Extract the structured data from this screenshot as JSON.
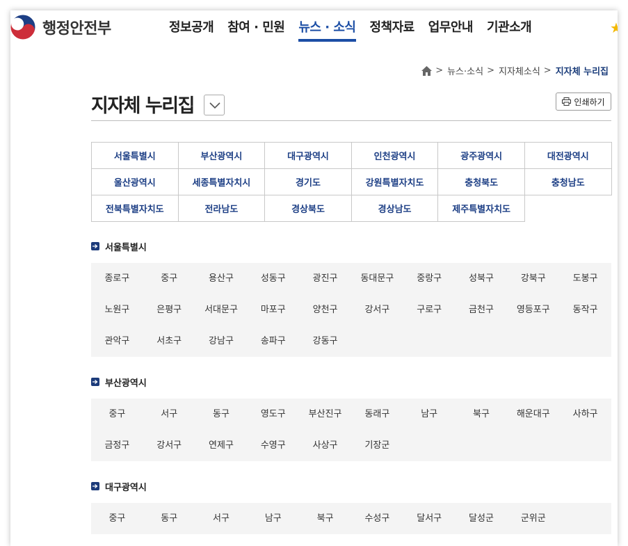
{
  "header": {
    "logo_text": "행정안전부",
    "nav": [
      "정보공개",
      "참여 · 민원",
      "뉴스 · 소식",
      "정책자료",
      "업무안내",
      "기관소개"
    ],
    "active_nav_index": 2
  },
  "breadcrumb": {
    "items": [
      "뉴스·소식",
      "지자체소식"
    ],
    "current": "지자체 누리집"
  },
  "page": {
    "title": "지자체 누리집",
    "print_label": "인쇄하기"
  },
  "regions": [
    [
      "서울특별시",
      "부산광역시",
      "대구광역시",
      "인천광역시",
      "광주광역시",
      "대전광역시"
    ],
    [
      "울산광역시",
      "세종특별자치시",
      "경기도",
      "강원특별자치도",
      "충청북도",
      "충청남도"
    ],
    [
      "전북특별자치도",
      "전라남도",
      "경상북도",
      "경상남도",
      "제주특별자치도"
    ]
  ],
  "sections": [
    {
      "title": "서울특별시",
      "districts": [
        "종로구",
        "중구",
        "용산구",
        "성동구",
        "광진구",
        "동대문구",
        "중랑구",
        "성북구",
        "강북구",
        "도봉구",
        "노원구",
        "은평구",
        "서대문구",
        "마포구",
        "양천구",
        "강서구",
        "구로구",
        "금천구",
        "영등포구",
        "동작구",
        "관악구",
        "서초구",
        "강남구",
        "송파구",
        "강동구"
      ]
    },
    {
      "title": "부산광역시",
      "districts": [
        "중구",
        "서구",
        "동구",
        "영도구",
        "부산진구",
        "동래구",
        "남구",
        "북구",
        "해운대구",
        "사하구",
        "금정구",
        "강서구",
        "연제구",
        "수영구",
        "사상구",
        "기장군"
      ]
    },
    {
      "title": "대구광역시",
      "districts": [
        "중구",
        "동구",
        "서구",
        "남구",
        "북구",
        "수성구",
        "달서구",
        "달성군",
        "군위군"
      ]
    }
  ],
  "colors": {
    "accent": "#1c4ea5",
    "region_text": "#1d3f85",
    "section_box": "#f4f4f4",
    "star": "#f3b800"
  }
}
